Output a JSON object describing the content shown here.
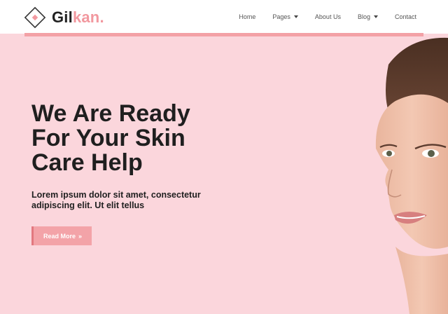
{
  "header": {
    "logo_main": "Gil",
    "logo_accent": "kan.",
    "nav": [
      {
        "label": "Home",
        "has_caret": false
      },
      {
        "label": "Pages",
        "has_caret": true
      },
      {
        "label": "About Us",
        "has_caret": false
      },
      {
        "label": "Blog",
        "has_caret": true
      },
      {
        "label": "Contact",
        "has_caret": false
      }
    ]
  },
  "hero": {
    "title_line1": "We Are Ready",
    "title_line2": "For Your Skin",
    "title_line3": "Care Help",
    "subtitle": "Lorem ipsum dolor sit amet, consectetur adipiscing elit. Ut elit tellus",
    "cta_label": "Read More",
    "cta_icon": "double-chevron-right-icon"
  },
  "colors": {
    "background": "#fbd6dc",
    "accent": "#f3a1a6",
    "text": "#1f1f1f"
  }
}
